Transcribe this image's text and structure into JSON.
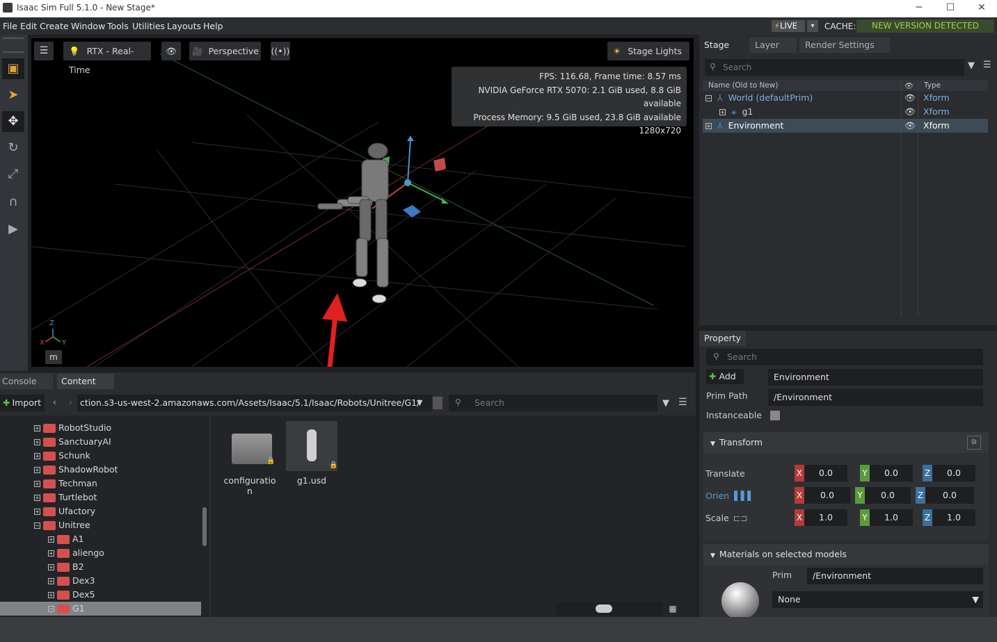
{
  "window": {
    "title": "Isaac Sim Full 5.1.0 - New Stage*",
    "minimize": "─",
    "maximize": "☐",
    "close": "✕"
  },
  "menu": [
    "File",
    "Edit",
    "Create",
    "Window",
    "Tools",
    "Utilities",
    "Layouts",
    "Help"
  ],
  "status": {
    "live": "LIVE",
    "cache_label": "CACHE:",
    "cache_value": "NEW VERSION DETECTED"
  },
  "viewport": {
    "renderer": "RTX - Real-Time",
    "camera": "Perspective",
    "stage_lights": "Stage Lights",
    "stats": [
      "FPS: 116.68, Frame time: 8.57 ms",
      "NVIDIA GeForce RTX 5070: 2.1 GiB used, 8.8 GiB available",
      "Process Memory: 9.5 GiB used, 23.8 GiB available",
      "1280x720"
    ],
    "unit": "m",
    "axis_z": "Z",
    "axis_x": "X",
    "axis_y": "Y"
  },
  "stage": {
    "tabs": [
      "Stage",
      "Layer",
      "Render Settings"
    ],
    "search_placeholder": "Search",
    "col_name": "Name (Old to New)",
    "col_type": "Type",
    "rows": [
      {
        "name": "World (defaultPrim)",
        "type": "Xform"
      },
      {
        "name": "g1",
        "type": "Xform"
      },
      {
        "name": "Environment",
        "type": "Xform"
      }
    ]
  },
  "property": {
    "tab": "Property",
    "search_placeholder": "Search",
    "add_label": "Add",
    "name_value": "Environment",
    "prim_path_label": "Prim Path",
    "prim_path_value": "/Environment",
    "instanceable_label": "Instanceable",
    "transform_label": "Transform",
    "translate_label": "Translate",
    "orient_label": "Orien",
    "scale_label": "Scale",
    "translate": [
      "0.0",
      "0.0",
      "0.0"
    ],
    "orient": [
      "0.0",
      "0.0",
      "0.0"
    ],
    "scale": [
      "1.0",
      "1.0",
      "1.0"
    ],
    "materials_label": "Materials on selected models",
    "prim_label": "Prim",
    "prim_value": "/Environment",
    "material_value": "None"
  },
  "content": {
    "tabs": [
      "Console",
      "Content"
    ],
    "import_label": "Import",
    "path": "ction.s3-us-west-2.amazonaws.com/Assets/Isaac/5.1/Isaac/Robots/Unitree/G1/",
    "search_placeholder": "Search",
    "tree": [
      {
        "label": "RobotStudio",
        "level": 0
      },
      {
        "label": "SanctuaryAI",
        "level": 0
      },
      {
        "label": "Schunk",
        "level": 0
      },
      {
        "label": "ShadowRobot",
        "level": 0
      },
      {
        "label": "Techman",
        "level": 0
      },
      {
        "label": "Turtlebot",
        "level": 0
      },
      {
        "label": "Ufactory",
        "level": 0
      },
      {
        "label": "Unitree",
        "level": 0
      },
      {
        "label": "A1",
        "level": 1
      },
      {
        "label": "aliengo",
        "level": 1
      },
      {
        "label": "B2",
        "level": 1
      },
      {
        "label": "Dex3",
        "level": 1
      },
      {
        "label": "Dex5",
        "level": 1
      },
      {
        "label": "G1",
        "level": 1
      }
    ],
    "files": [
      {
        "name1": "configuratio",
        "name2": "n"
      },
      {
        "name1": "g1.usd",
        "name2": ""
      }
    ]
  }
}
